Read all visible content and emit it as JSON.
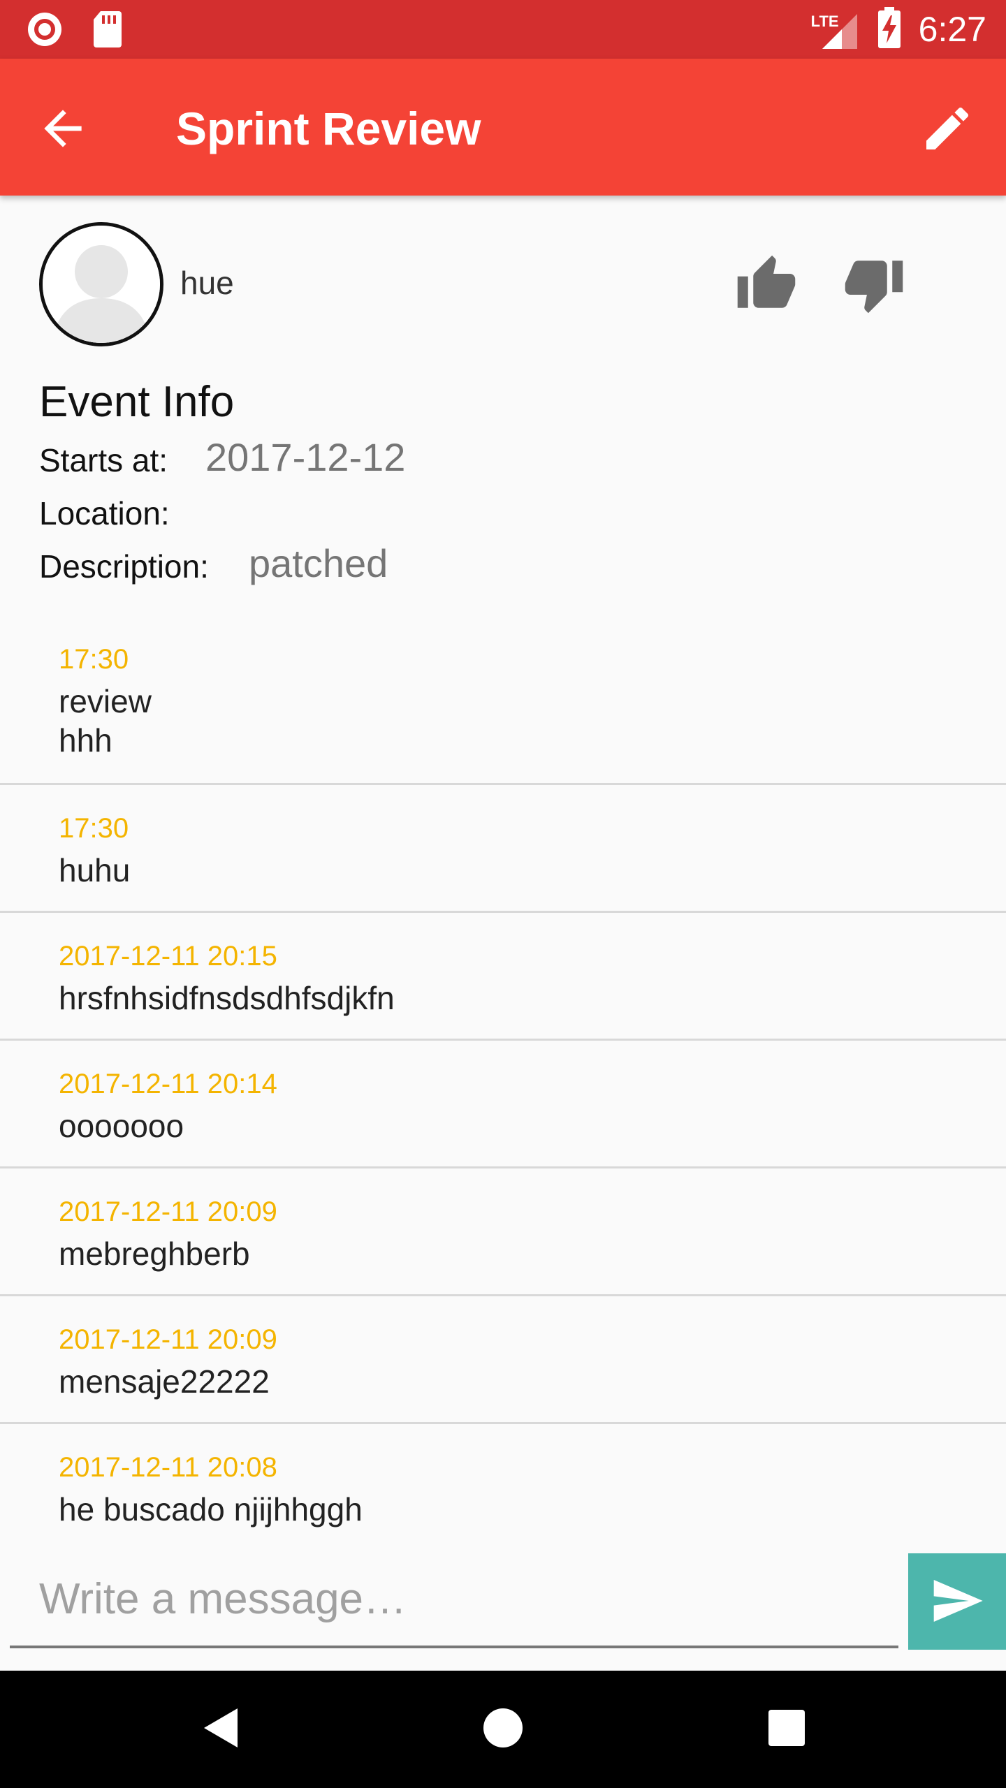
{
  "status_bar": {
    "time": "6:27",
    "network_label": "LTE",
    "icons": [
      "record-icon",
      "sd-card-icon",
      "signal-icon",
      "battery-charging-icon"
    ]
  },
  "app_bar": {
    "title": "Sprint Review",
    "icons": {
      "back": "arrow-back-icon",
      "edit": "pencil-icon"
    }
  },
  "event_header": {
    "author": "hue",
    "icons": {
      "like": "thumb-up-icon",
      "dislike": "thumb-down-icon"
    }
  },
  "event_info": {
    "heading": "Event Info",
    "starts_at_label": "Starts at:",
    "starts_at_value": "2017-12-12",
    "location_label": "Location:",
    "location_value": "",
    "description_label": "Description:",
    "description_value": "patched"
  },
  "messages": [
    {
      "time": "17:30",
      "text": "review\nhhh"
    },
    {
      "time": "17:30",
      "text": "huhu"
    },
    {
      "time": "2017-12-11 20:15",
      "text": "hrsfnhsidfnsdsdhfsdjkfn"
    },
    {
      "time": "2017-12-11 20:14",
      "text": "ooooooo"
    },
    {
      "time": "2017-12-11 20:09",
      "text": "mebreghberb"
    },
    {
      "time": "2017-12-11 20:09",
      "text": "mensaje22222"
    },
    {
      "time": "2017-12-11 20:08",
      "text": "he buscado njijhhggh"
    }
  ],
  "composer": {
    "placeholder": "Write a message…",
    "send_icon": "send-icon"
  },
  "nav_bar": {
    "icons": [
      "nav-back-icon",
      "nav-home-icon",
      "nav-recents-icon"
    ]
  },
  "colors": {
    "status_bar": "#d32f2f",
    "app_bar": "#f44336",
    "timestamp": "#f4b400",
    "send_button": "#4db6ac"
  }
}
